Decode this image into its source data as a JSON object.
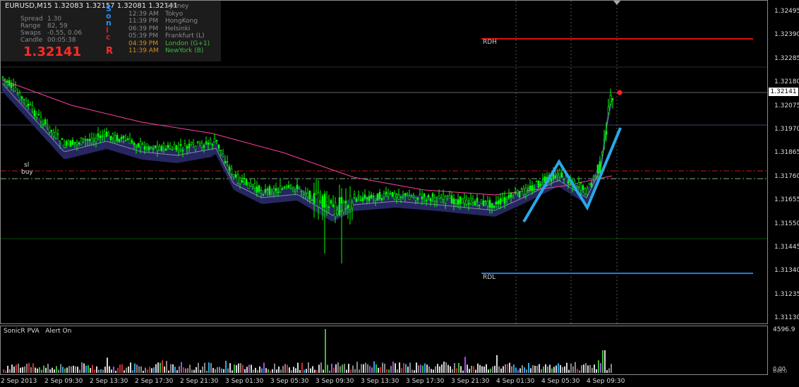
{
  "symbol_line": "EURUSD,M15  1.32083 1.32157 1.32081 1.32141",
  "stats": [
    {
      "label": "Spread",
      "value": "1.30"
    },
    {
      "label": "Range",
      "value": "82, 59"
    },
    {
      "label": "Swaps",
      "value": "-0.55, 0.06"
    },
    {
      "label": "Candle",
      "value": "00:05:38"
    }
  ],
  "big_price": "1.32141",
  "sessions": [
    {
      "time": "",
      "city": "Sydney",
      "color": "#8a8a8a"
    },
    {
      "time": "12:39 AM",
      "city": "Tokyo",
      "color": "#8a8a8a"
    },
    {
      "time": "11:39 PM",
      "city": "HongKong",
      "color": "#8a8a8a"
    },
    {
      "time": "06:39 PM",
      "city": "Helsinki",
      "color": "#8a8a8a"
    },
    {
      "time": "05:39 PM",
      "city": "Frankfurt  (L)",
      "color": "#8a8a8a"
    },
    {
      "time": "04:39 PM",
      "city": "London  (G+1)",
      "color": "#d98a20"
    },
    {
      "time": "11:39 AM",
      "city": "NewYork  (B)",
      "color": "#d98a20"
    }
  ],
  "sessions_city_colors": [
    "#8a8a8a",
    "#8a8a8a",
    "#8a8a8a",
    "#8a8a8a",
    "#8a8a8a",
    "#3fb83f",
    "#3fb83f"
  ],
  "sonic_letters": [
    {
      "ch": "S",
      "color": "#1e90ff"
    },
    {
      "ch": "o",
      "color": "#1e90ff"
    },
    {
      "ch": "n",
      "color": "#1e90ff"
    },
    {
      "ch": "i",
      "color": "#d42020"
    },
    {
      "ch": "c",
      "color": "#d42020"
    },
    {
      "ch": "R",
      "color": "#ff2a2a"
    }
  ],
  "price_axis": [
    "1.32495",
    "1.32390",
    "1.32285",
    "1.32180",
    "1.32075",
    "1.31970",
    "1.31865",
    "1.31760",
    "1.31655",
    "1.31550",
    "1.31445",
    "1.31340",
    "1.31235",
    "1.31130"
  ],
  "current_price": "1.32141",
  "time_axis": [
    "2 Sep 2013",
    "2 Sep 09:30",
    "2 Sep 13:30",
    "2 Sep 17:30",
    "2 Sep 21:30",
    "3 Sep 01:30",
    "3 Sep 05:30",
    "3 Sep 09:30",
    "3 Sep 13:30",
    "3 Sep 17:30",
    "3 Sep 21:30",
    "4 Sep 01:30",
    "4 Sep 05:30",
    "4 Sep 09:30"
  ],
  "levels": {
    "rdh": "RDH",
    "rdl": "RDL"
  },
  "trade_labels": {
    "sl": "sl",
    "buy": "buy"
  },
  "pva": {
    "title": "SonicR PVA",
    "alert": "Alert On",
    "max": "4596.9",
    "zero": "0.00",
    "tiny": "648.0"
  },
  "colors": {
    "bull": "#00ff00",
    "bear": "#00ff00",
    "dragon": "#2a2a6a",
    "pink": "#ff3fa0",
    "zigzag": "#2aa8e8",
    "rdh": "#e01010",
    "rdl": "#1a7de0"
  },
  "chart_data": {
    "type": "candlestick",
    "symbol": "EURUSD",
    "timeframe": "M15",
    "ohlc_last": {
      "open": 1.32083,
      "high": 1.32157,
      "low": 1.32081,
      "close": 1.32141
    },
    "ylim": [
      1.3113,
      1.32495
    ],
    "levels": {
      "RDH": 1.3239,
      "RDL": 1.3134
    },
    "zigzag_points": [
      1.3157,
      1.3183,
      1.31635,
      1.3199
    ]
  }
}
